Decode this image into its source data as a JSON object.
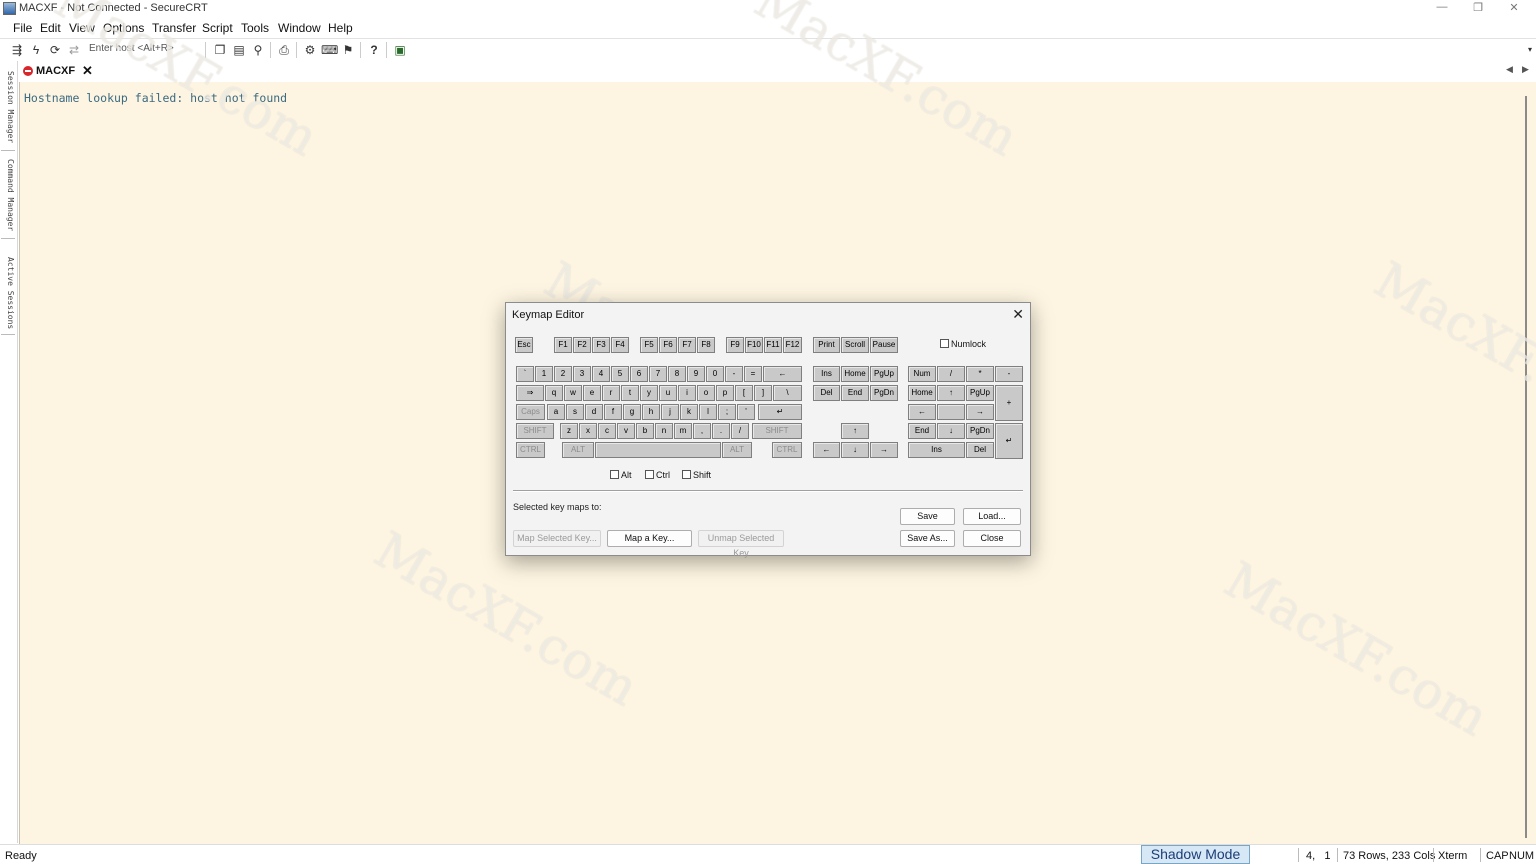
{
  "window": {
    "title": "MACXF - Not Connected - SecureCRT",
    "controls": {
      "minimize": "—",
      "restore": "❐",
      "close": "✕"
    }
  },
  "menu": [
    "File",
    "Edit",
    "View",
    "Options",
    "Transfer",
    "Script",
    "Tools",
    "Window",
    "Help"
  ],
  "toolbar": {
    "quick_connect_hint": "Enter host <Alt+R>",
    "icons": [
      "connect-bar-icon",
      "lightning-icon",
      "reconnect-icon",
      "disconnect-icon",
      "copy-icon",
      "paste-icon",
      "find-icon",
      "print-icon",
      "settings-icon",
      "keymap-icon",
      "sftp-icon",
      "help-icon",
      "screen-icon"
    ]
  },
  "tabs": [
    {
      "label": "MACXF",
      "status": "disconnected",
      "status_color": "#d9262b"
    }
  ],
  "sidebar": [
    "Session Manager",
    "Command Manager",
    "Active Sessions"
  ],
  "terminal": {
    "line": "Hostname lookup failed: host not found",
    "background": "#fdf5e1",
    "text_color": "#3b6a82"
  },
  "watermark": "MacXF.com",
  "status": {
    "left": "Ready",
    "shadow_mode": "Shadow Mode",
    "cursor": "4,   1",
    "size": "73 Rows, 233 Cols",
    "terminal_type": "Xterm",
    "cap": "CAP",
    "num": "NUM"
  },
  "dialog": {
    "title": "Keymap Editor",
    "close": "✕",
    "function_row": [
      "Esc",
      "F1",
      "F2",
      "F3",
      "F4",
      "F5",
      "F6",
      "F7",
      "F8",
      "F9",
      "F10",
      "F11",
      "F12",
      "Print",
      "Scroll",
      "Pause"
    ],
    "row_num": [
      "`",
      "1",
      "2",
      "3",
      "4",
      "5",
      "6",
      "7",
      "8",
      "9",
      "0",
      "-",
      "=",
      "←"
    ],
    "row_q": [
      "⇒",
      "q",
      "w",
      "e",
      "r",
      "t",
      "y",
      "u",
      "i",
      "o",
      "p",
      "[",
      "]",
      "\\"
    ],
    "row_a": [
      "Caps",
      "a",
      "s",
      "d",
      "f",
      "g",
      "h",
      "j",
      "k",
      "l",
      ";",
      "'",
      "↵"
    ],
    "row_z": [
      "SHIFT",
      "z",
      "x",
      "c",
      "v",
      "b",
      "n",
      "m",
      ",",
      ".",
      "/",
      "SHIFT"
    ],
    "row_bottom": [
      "CTRL",
      "ALT",
      "",
      "ALT",
      "CTRL"
    ],
    "nav": [
      "Ins",
      "Home",
      "PgUp",
      "Del",
      "End",
      "PgDn"
    ],
    "arrows": [
      "↑",
      "←",
      "↓",
      "→"
    ],
    "numpad": [
      "Num",
      "/",
      "*",
      "-",
      "Home",
      "↑",
      "PgUp",
      "+",
      "←",
      "",
      "→",
      "End",
      "↓",
      "PgDn",
      "↵",
      "Ins",
      "Del"
    ],
    "numlock_label": "Numlock",
    "modifiers": [
      "Alt",
      "Ctrl",
      "Shift"
    ],
    "maps_label": "Selected key maps to:",
    "buttons": {
      "save": "Save",
      "load": "Load...",
      "save_as": "Save As...",
      "close": "Close",
      "map_selected": "Map Selected Key...",
      "map_a_key": "Map a Key...",
      "unmap": "Unmap Selected Key"
    }
  }
}
